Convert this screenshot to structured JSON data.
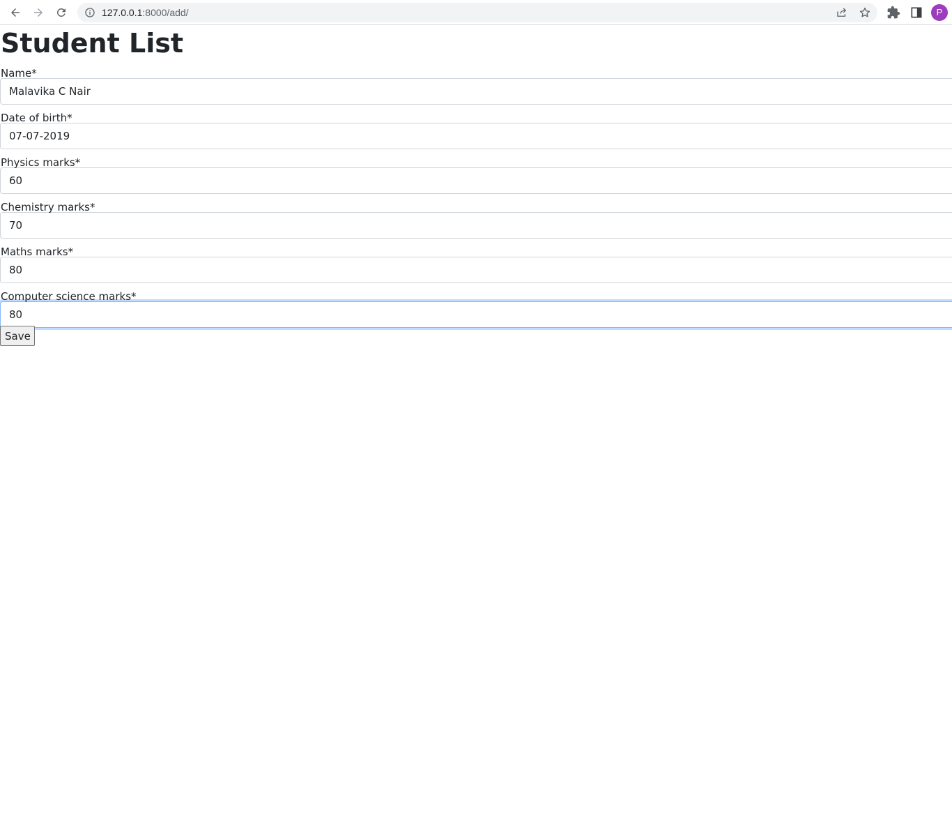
{
  "browser": {
    "url_host": "127.0.0.1",
    "url_path": ":8000/add/",
    "profile_initial": "P",
    "icons": [
      "back-icon",
      "forward-icon",
      "reload-icon",
      "site-info-icon",
      "share-icon",
      "bookmark-star-icon",
      "extensions-icon",
      "side-panel-icon"
    ]
  },
  "page": {
    "title": "Student List",
    "fields": [
      {
        "label": "Name*",
        "value": "Malavika C Nair"
      },
      {
        "label": "Date of birth*",
        "value": "07-07-2019"
      },
      {
        "label": "Physics marks*",
        "value": "60"
      },
      {
        "label": "Chemistry marks*",
        "value": "70"
      },
      {
        "label": "Maths marks*",
        "value": "80"
      },
      {
        "label": "Computer science marks*",
        "value": "80"
      }
    ],
    "save_label": "Save"
  }
}
